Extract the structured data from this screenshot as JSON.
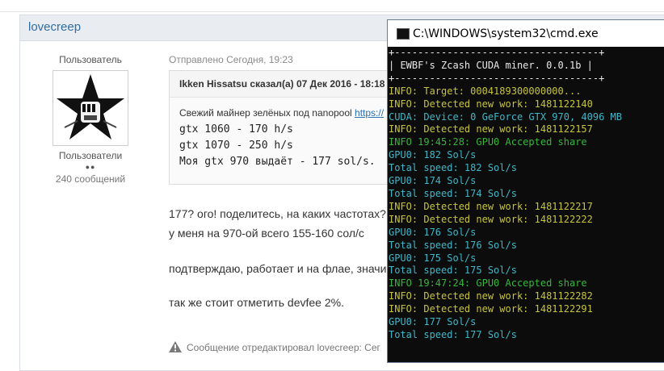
{
  "forum": {
    "author_name": "lovecreep",
    "user": {
      "title": "Пользователь",
      "group": "Пользователи",
      "rep_dots": "●●",
      "post_count": "240 сообщений"
    },
    "post": {
      "date": "Отправлено Сегодня, 19:23",
      "quote": {
        "header": "Ikken Hissatsu сказал(а) 07 Дек 2016 - 18:18",
        "intro": "Свежий майнер зелёных под nanopool ",
        "link": "https://",
        "lines": [
          "gtx 1060 - 170 h/s",
          "gtx 1070 - 250 h/s",
          "Моя gtx 970 выдаёт - 177 sol/s."
        ]
      },
      "text_lines": [
        "177? ого! поделитесь, на каких частотах?",
        "у меня на 970-ой всего 155-160 сол/с",
        "подтверждаю, работает и на флае, значи",
        "так же стоит отметить devfee 2%."
      ],
      "edit_note": "Сообщение отредактировал lovecreep: Сег"
    }
  },
  "cmd": {
    "title": "C:\\WINDOWS\\system32\\cmd.exe",
    "icon": "cmd-icon",
    "colors": {
      "white": "#e8e8e8",
      "yellow": "#c7c43a",
      "cyan": "#3eb7c9",
      "green": "#38b53e"
    },
    "lines": [
      {
        "text": "+-----------------------------------+",
        "color": "white"
      },
      {
        "text": "| EWBF's Zcash CUDA miner. 0.0.1b |",
        "color": "white"
      },
      {
        "text": "+-----------------------------------+",
        "color": "white"
      },
      {
        "text": "INFO: Target: 0004189300000000...",
        "color": "yellow"
      },
      {
        "text": "INFO: Detected new work: 1481122140",
        "color": "yellow"
      },
      {
        "text": "CUDA: Device: 0 GeForce GTX 970, 4096 MB",
        "color": "cyan"
      },
      {
        "text": "INFO: Detected new work: 1481122157",
        "color": "yellow"
      },
      {
        "text": "INFO 19:45:28: GPU0 Accepted share",
        "color": "green"
      },
      {
        "text": "GPU0: 182 Sol/s",
        "color": "cyan"
      },
      {
        "text": "Total speed: 182 Sol/s",
        "color": "cyan"
      },
      {
        "text": "GPU0: 174 Sol/s",
        "color": "cyan"
      },
      {
        "text": "Total speed: 174 Sol/s",
        "color": "cyan"
      },
      {
        "text": "INFO: Detected new work: 1481122217",
        "color": "yellow"
      },
      {
        "text": "INFO: Detected new work: 1481122222",
        "color": "yellow"
      },
      {
        "text": "GPU0: 176 Sol/s",
        "color": "cyan"
      },
      {
        "text": "Total speed: 176 Sol/s",
        "color": "cyan"
      },
      {
        "text": "GPU0: 175 Sol/s",
        "color": "cyan"
      },
      {
        "text": "Total speed: 175 Sol/s",
        "color": "cyan"
      },
      {
        "text": "INFO 19:47:24: GPU0 Accepted share",
        "color": "green"
      },
      {
        "text": "INFO: Detected new work: 1481122282",
        "color": "yellow"
      },
      {
        "text": "INFO: Detected new work: 1481122291",
        "color": "yellow"
      },
      {
        "text": "GPU0: 177 Sol/s",
        "color": "cyan"
      },
      {
        "text": "Total speed: 177 Sol/s",
        "color": "cyan"
      }
    ]
  }
}
